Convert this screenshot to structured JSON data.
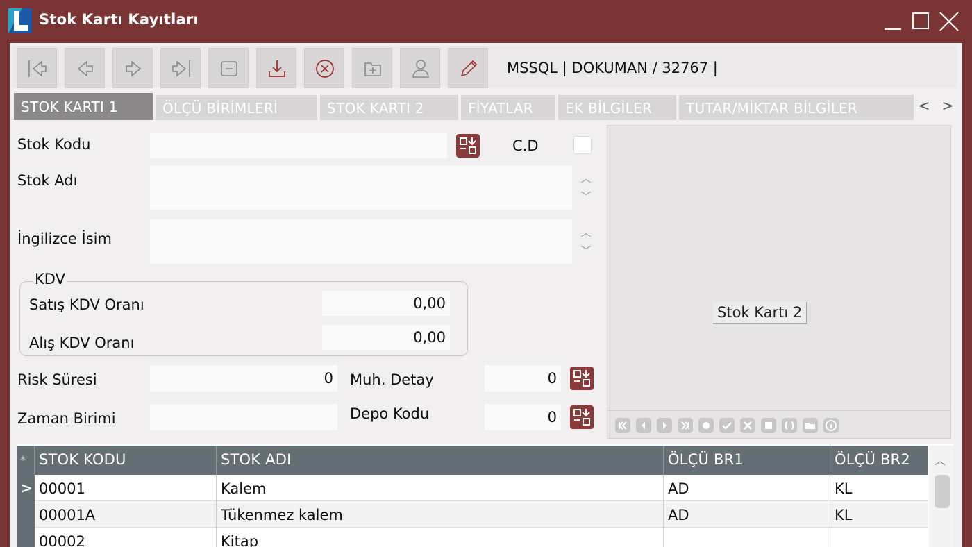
{
  "window": {
    "title": "Stok Kartı Kayıtları"
  },
  "toolbar": {
    "buttons": [
      "first-record-icon",
      "previous-record-icon",
      "next-record-icon",
      "last-record-icon",
      "minimize-form-icon",
      "save-icon",
      "cancel-icon",
      "new-record-icon",
      "user-icon",
      "edit-icon"
    ],
    "db_info": "MSSQL | DOKUMAN / 32767 |"
  },
  "tabs": [
    {
      "label": "STOK KARTI 1",
      "active": true
    },
    {
      "label": "ÖLÇÜ BİRİMLERİ",
      "active": false
    },
    {
      "label": "STOK KARTI 2",
      "active": false
    },
    {
      "label": "FİYATLAR",
      "active": false
    },
    {
      "label": "EK BİLGİLER",
      "active": false
    },
    {
      "label": "TUTAR/MİKTAR BİLGİLER",
      "active": false
    }
  ],
  "tab_scroll": {
    "left": "<",
    "right": ">"
  },
  "form": {
    "stok_kodu": {
      "label": "Stok Kodu",
      "value": ""
    },
    "cd": {
      "label": "C.D",
      "checked": false
    },
    "stok_adi": {
      "label": "Stok Adı",
      "value": ""
    },
    "ingilizce_isim": {
      "label": "İngilizce İsim",
      "value": ""
    },
    "kdv": {
      "legend": "KDV",
      "satis": {
        "label": "Satış KDV Oranı",
        "value": "0,00"
      },
      "alis": {
        "label": "Alış KDV Oranı",
        "value": "0,00"
      }
    },
    "risk_suresi": {
      "label": "Risk Süresi",
      "value": "0"
    },
    "muh_detay": {
      "label": "Muh. Detay",
      "value": "0"
    },
    "zaman_birimi": {
      "label": "Zaman Birimi",
      "value": ""
    },
    "depo_kodu": {
      "label": "Depo Kodu",
      "value": "0"
    }
  },
  "image_panel": {
    "caption": "Stok Kartı 2"
  },
  "grid": {
    "columns": [
      "STOK KODU",
      "STOK ADI",
      "ÖLÇÜ BR1",
      "ÖLÇÜ BR2"
    ],
    "rows": [
      [
        "00001",
        "Kalem",
        "AD",
        "KL"
      ],
      [
        "00001A",
        "Tükenmez kalem",
        "AD",
        "KL"
      ],
      [
        "00002",
        "Kitap",
        "",
        ""
      ]
    ],
    "current_row_marker": ">",
    "header_marker": "*"
  },
  "colors": {
    "title_bar": "#7b3434",
    "grid_header": "#636f75",
    "active_tab": "#8a8888",
    "lookup_icon": "#8b3a3a"
  }
}
